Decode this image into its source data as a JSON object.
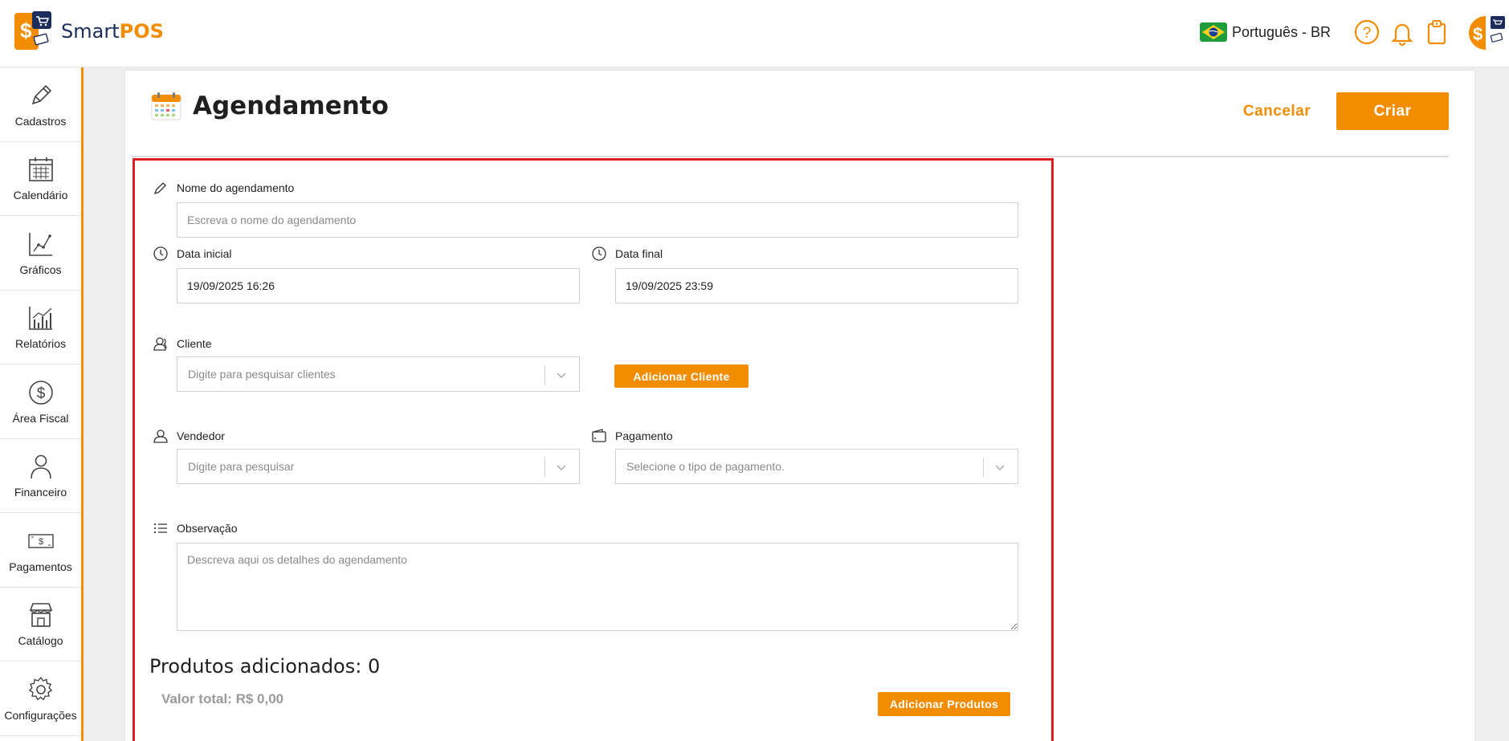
{
  "brand": {
    "name_part1": "Smart",
    "name_part2": "POS",
    "accent": "#f28c00",
    "navy": "#1b2d5b"
  },
  "header": {
    "language": "Português - BR",
    "icons": [
      "help-icon",
      "bell-icon",
      "clipboard-icon",
      "user-avatar"
    ]
  },
  "sidebar": {
    "items": [
      {
        "label": "Cadastros",
        "icon": "pencil-icon"
      },
      {
        "label": "Calendário",
        "icon": "calendar-icon"
      },
      {
        "label": "Gráficos",
        "icon": "chart-line-icon"
      },
      {
        "label": "Relatórios",
        "icon": "bar-chart-icon"
      },
      {
        "label": "Área Fiscal",
        "icon": "dollar-circle-icon"
      },
      {
        "label": "Financeiro",
        "icon": "person-icon"
      },
      {
        "label": "Pagamentos",
        "icon": "banknote-icon"
      },
      {
        "label": "Catálogo",
        "icon": "store-icon"
      },
      {
        "label": "Configurações",
        "icon": "gear-icon"
      }
    ]
  },
  "page": {
    "title": "Agendamento",
    "cancel_label": "Cancelar",
    "create_label": "Criar"
  },
  "form": {
    "name_label": "Nome do agendamento",
    "name_placeholder": "Escreva o nome do agendamento",
    "start_label": "Data inicial",
    "start_value": "19/09/2025 16:26",
    "end_label": "Data final",
    "end_value": "19/09/2025 23:59",
    "client_label": "Cliente",
    "client_placeholder": "Digite para pesquisar clientes",
    "add_client_label": "Adicionar Cliente",
    "seller_label": "Vendedor",
    "seller_placeholder": "Digite para pesquisar",
    "payment_label": "Pagamento",
    "payment_placeholder": "Selecione o tipo de pagamento.",
    "notes_label": "Observação",
    "notes_placeholder": "Descreva aqui os detalhes do agendamento"
  },
  "products": {
    "title": "Produtos adicionados: 0",
    "total": "Valor total: R$ 0,00",
    "add_label": "Adicionar Produtos"
  }
}
